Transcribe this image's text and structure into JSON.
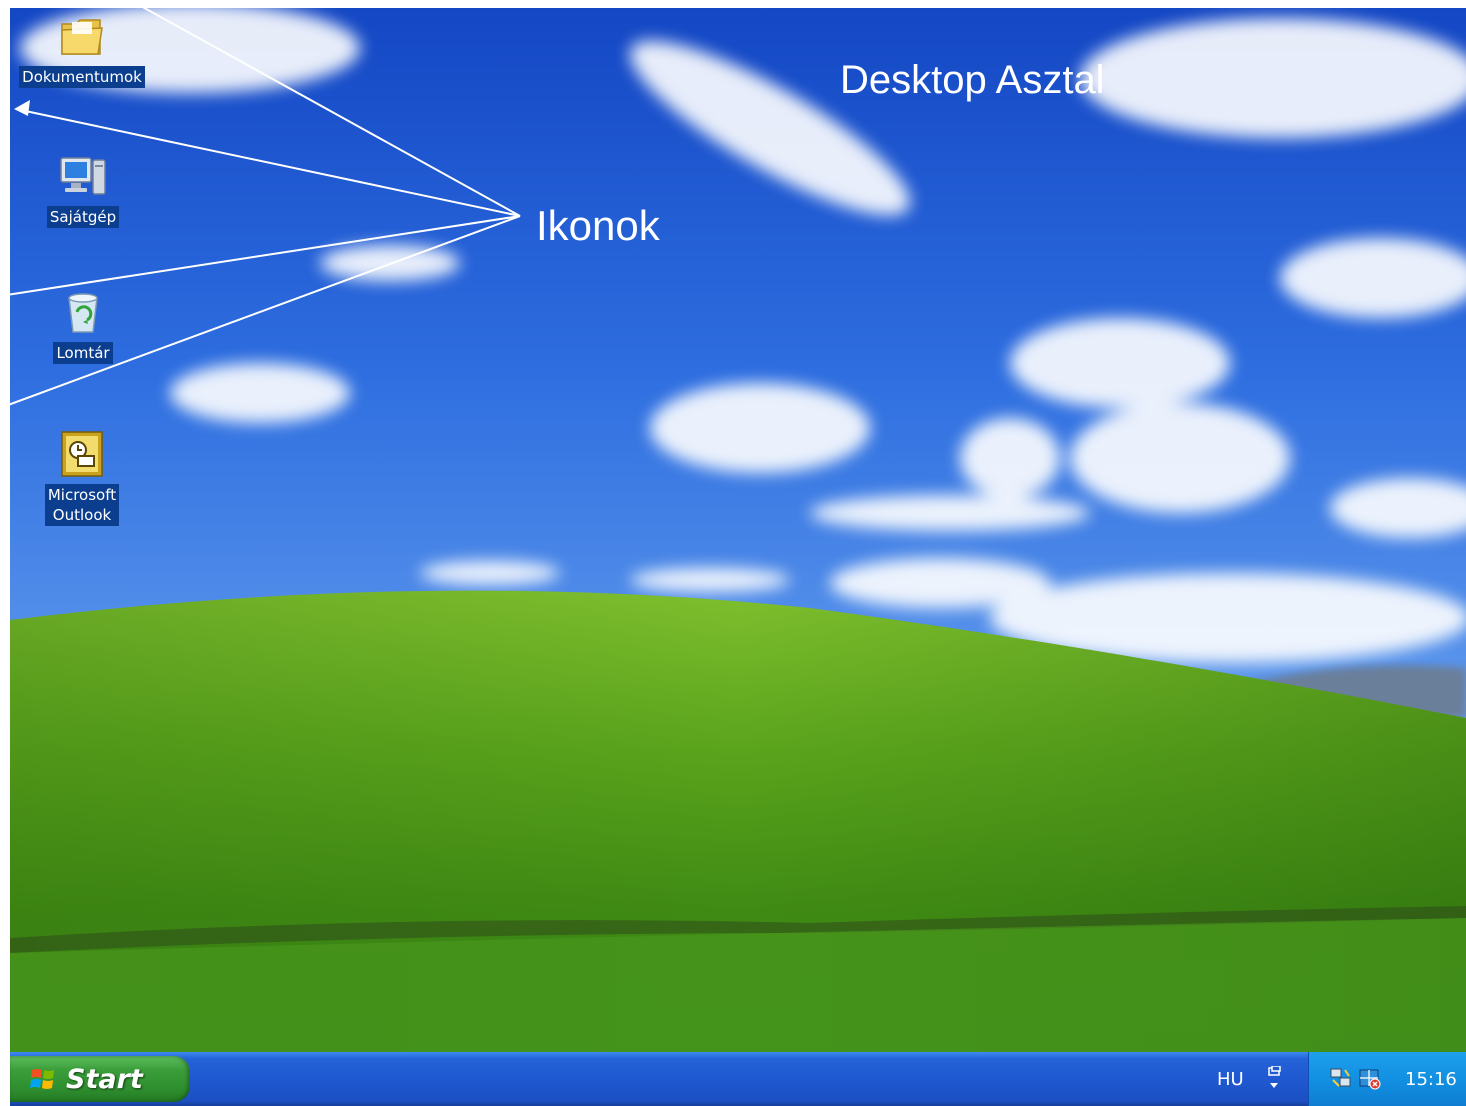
{
  "desktop": {
    "annotation_title": "Desktop  Asztal",
    "annotation_icons": "Ikonok",
    "icons": [
      {
        "label": "Dokumentumok",
        "icon": "folder-icon"
      },
      {
        "label": "Sajátgép",
        "icon": "my-computer-icon"
      },
      {
        "label": "Lomtár",
        "icon": "recycle-bin-icon"
      },
      {
        "label": "Microsoft\nOutlook",
        "icon": "outlook-icon"
      }
    ]
  },
  "taskbar": {
    "start_label": "Start",
    "language": "HU",
    "clock": "15:16"
  },
  "colors": {
    "sky": "#1e5fd8",
    "grass": "#4f9a1e",
    "taskbar": "#1f58d0",
    "start_button": "#3a9e3a",
    "tray": "#1290e2",
    "icon_label_bg": "#0b3e8f"
  }
}
